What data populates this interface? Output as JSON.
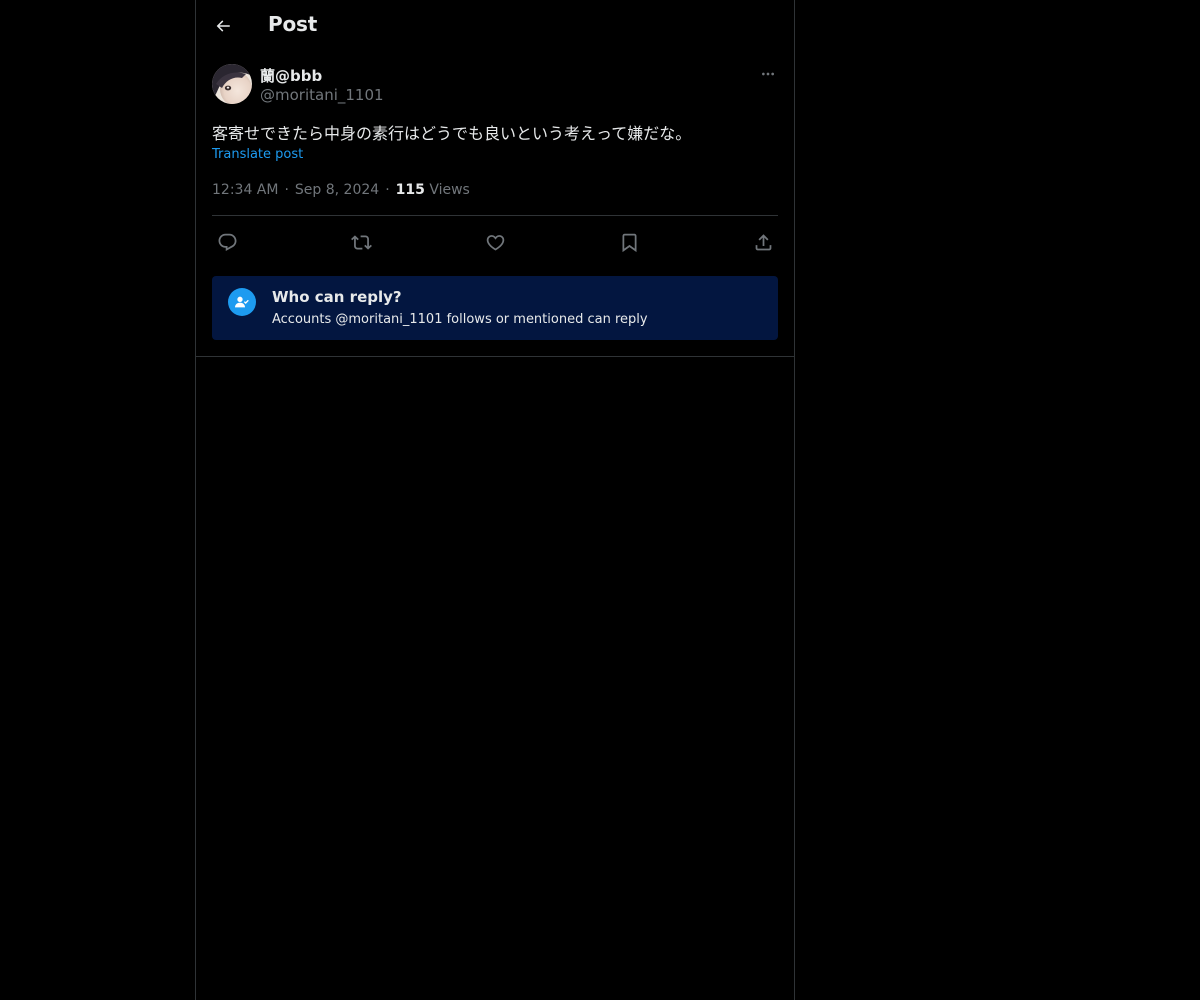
{
  "header": {
    "title": "Post",
    "back_icon": "arrow-left-icon"
  },
  "post": {
    "author": {
      "display_name": "蘭@bbb",
      "handle": "@moritani_1101"
    },
    "text": "客寄せできたら中身の素行はどうでも良いという考えって嫌だな。",
    "translate_label": "Translate post",
    "time": "12:34 AM",
    "date": "Sep 8, 2024",
    "separator": "·",
    "views_count": "115",
    "views_label": "Views",
    "actions": [
      {
        "name": "reply",
        "icon": "reply-icon"
      },
      {
        "name": "repost",
        "icon": "repost-icon"
      },
      {
        "name": "like",
        "icon": "heart-icon"
      },
      {
        "name": "bookmark",
        "icon": "bookmark-icon"
      },
      {
        "name": "share",
        "icon": "share-icon"
      }
    ]
  },
  "reply_restriction": {
    "title": "Who can reply?",
    "description": "Accounts @moritani_1101 follows or mentioned can reply",
    "icon": "person-check-icon"
  },
  "colors": {
    "background": "#000000",
    "text_primary": "#e7e9ea",
    "text_secondary": "#71767b",
    "accent": "#1d9bf0",
    "card_bg": "#031640",
    "border": "#2f3336"
  }
}
